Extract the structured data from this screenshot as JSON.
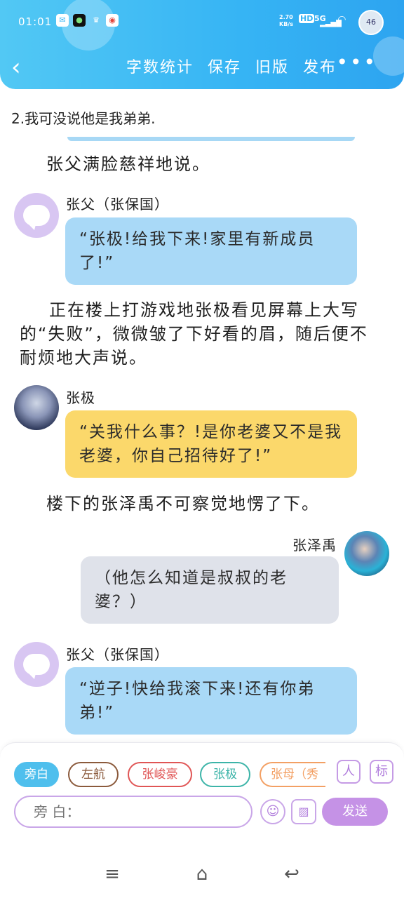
{
  "status_bar": {
    "time": "01:01",
    "net_speed": "2.70 KB/s",
    "hd": "HD",
    "network": "5G",
    "avatar_text": "46"
  },
  "header": {
    "back_label": "‹",
    "actions": [
      "字数统计",
      "保存",
      "旧版",
      "发布"
    ],
    "more_label": "•••"
  },
  "content": {
    "intro": "2.我可没说他是我弟弟.",
    "narrations": [
      "张父满脸慈祥地说。",
      "正在楼上打游戏地张极看见屏幕上大写的“失败”，微微皱了下好看的眉，随后便不耐烦地大声说。",
      "楼下的张泽禹不可察觉地愣了下。"
    ],
    "messages": [
      {
        "speaker": "张父（张保国）",
        "text": "“张极!给我下来!家里有新成员了!”"
      },
      {
        "speaker": "张极",
        "text": "“关我什么事？!是你老婆又不是我老婆，你自己招待好了!”"
      },
      {
        "speaker": "张泽禹",
        "text": "（他怎么知道是叔叔的老婆？）"
      },
      {
        "speaker": "张父（张保国）",
        "text": "“逆子!快给我滚下来!还有你弟弟!”"
      }
    ]
  },
  "panel": {
    "chips": [
      "旁白",
      "左航",
      "张峻豪",
      "张极",
      "张母（秀"
    ],
    "side_buttons": [
      "人",
      "标"
    ],
    "input_placeholder": "旁 白：",
    "emoji_icon": "☺",
    "image_icon": "▨",
    "send_label": "发送"
  },
  "navbar": {
    "menu": "≡",
    "home": "⌂",
    "back": "↩"
  },
  "colors": {
    "header": "#36b4f4",
    "bubble_blue": "#a9d9f7",
    "bubble_yellow": "#fbd86b",
    "bubble_gray": "#dfe2ea",
    "accent_purple": "#c592e6"
  }
}
